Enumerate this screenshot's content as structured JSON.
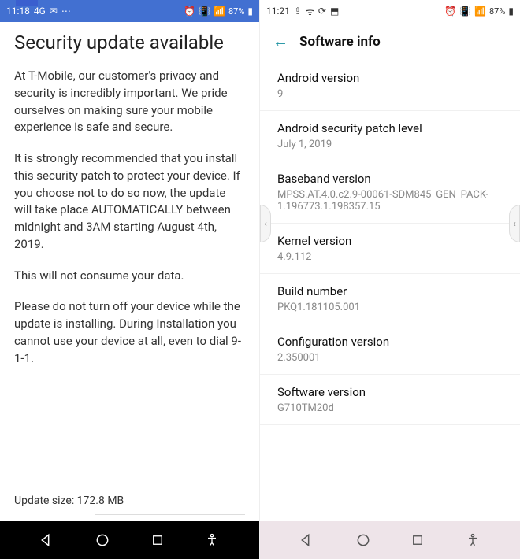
{
  "left": {
    "status": {
      "time": "11:18",
      "net": "4G",
      "battery": "87%"
    },
    "heading": "Security update available",
    "p1": "At T-Mobile, our customer's privacy and security is incredibly important. We pride ourselves on making sure your mobile experience is safe and secure.",
    "p2": "It is strongly recommended that you install this security patch to protect your device. If you choose not to do so now, the update will take place AUTOMATICALLY between midnight and 3AM starting August 4th, 2019.",
    "p3": "This will not consume your data.",
    "p4": "Please do not turn off your device while the update is installing. During Installation you cannot use your device at all, even to dial 9-1-1.",
    "update_size": "Update size: 172.8 MB"
  },
  "right": {
    "status": {
      "time": "11:21",
      "battery": "87%"
    },
    "header_title": "Software info",
    "rows": [
      {
        "label": "Android version",
        "value": "9"
      },
      {
        "label": "Android security patch level",
        "value": "July 1, 2019"
      },
      {
        "label": "Baseband version",
        "value": "MPSS.AT.4.0.c2.9-00061-SDM845_GEN_PACK-1.196773.1.198357.15"
      },
      {
        "label": "Kernel version",
        "value": "4.9.112"
      },
      {
        "label": "Build number",
        "value": "PKQ1.181105.001"
      },
      {
        "label": "Configuration version",
        "value": "2.350001"
      },
      {
        "label": "Software version",
        "value": "G710TM20d"
      }
    ]
  }
}
